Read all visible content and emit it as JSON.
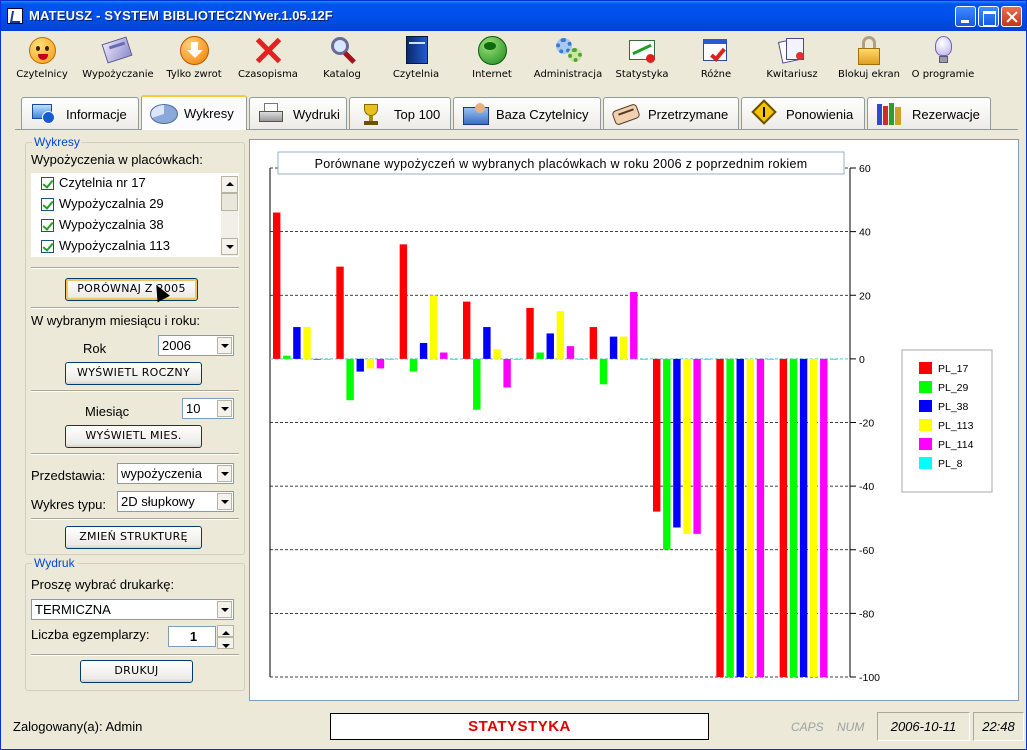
{
  "window": {
    "title": "MATEUSZ - SYSTEM BIBLIOTECZNY",
    "version": "ver.1.05.12F"
  },
  "toolbar": {
    "items": [
      {
        "label": "Czytelnicy",
        "icon": "smiley-icon"
      },
      {
        "label": "Wypożyczanie",
        "icon": "book-transfer-icon"
      },
      {
        "label": "Tylko zwrot",
        "icon": "orange-down-arrow-icon"
      },
      {
        "label": "Czasopisma",
        "icon": "red-x-icon"
      },
      {
        "label": "Katalog",
        "icon": "magnifier-icon"
      },
      {
        "label": "Czytelnia",
        "icon": "blue-book-icon"
      },
      {
        "label": "Internet",
        "icon": "globe-icon"
      },
      {
        "label": "Administracja",
        "icon": "gears-icon"
      },
      {
        "label": "Statystyka",
        "icon": "chart-icon"
      },
      {
        "label": "Różne",
        "icon": "calendar-check-icon"
      },
      {
        "label": "Kwitariusz",
        "icon": "receipts-icon"
      },
      {
        "label": "Blokuj ekran",
        "icon": "padlock-icon"
      },
      {
        "label": "O programie",
        "icon": "lightbulb-icon"
      }
    ]
  },
  "tabs": [
    {
      "label": "Informacje",
      "icon": "computer-info-icon"
    },
    {
      "label": "Wykresy",
      "icon": "pie-chart-icon"
    },
    {
      "label": "Wydruki",
      "icon": "printer-icon"
    },
    {
      "label": "Top 100",
      "icon": "trophy-icon"
    },
    {
      "label": "Baza Czytelnicy",
      "icon": "folder-people-icon"
    },
    {
      "label": "Przetrzymane",
      "icon": "hand-clock-icon"
    },
    {
      "label": "Ponowienia",
      "icon": "warning-sign-icon"
    },
    {
      "label": "Rezerwacje",
      "icon": "books-shelf-icon"
    }
  ],
  "wykresy": {
    "legend": "Wykresy",
    "loans_label": "Wypożyczenia w placówkach:",
    "branches": [
      "Czytelnia nr 17",
      "Wypożyczalnia 29",
      "Wypożyczalnia 38",
      "Wypożyczalnia 113"
    ],
    "compare_button": "PORÓWNAJ Z 2005",
    "month_year_label": "W wybranym miesiącu i roku:",
    "year_label": "Rok",
    "year_value": "2006",
    "show_yearly_button": "WYŚWIETL ROCZNY",
    "month_label": "Miesiąc",
    "month_value": "10",
    "show_monthly_button": "WYŚWIETL MIES.",
    "represents_label": "Przedstawia:",
    "represents_value": "wypożyczenia",
    "chart_type_label": "Wykres typu:",
    "chart_type_value": "2D słupkowy",
    "change_structure_button": "ZMIEŃ STRUKTURĘ"
  },
  "wydruk": {
    "legend": "Wydruk",
    "printer_label": "Proszę wybrać drukarkę:",
    "printer_value": "TERMICZNA",
    "copies_label": "Liczba egzemplarzy:",
    "copies_value": "1",
    "print_button": "DRUKUJ"
  },
  "status": {
    "logged_in": "Zalogowany(a): Admin",
    "module": "STATYSTYKA",
    "caps": "CAPS",
    "num": "NUM",
    "date": "2006-10-11",
    "time": "22:48"
  },
  "chart_data": {
    "type": "bar",
    "title": "Porównane wypożyczeń w wybranych placówkach w roku 2006 z poprzednim rokiem",
    "ylim": [
      -100,
      60
    ],
    "yticks": [
      60,
      40,
      20,
      0,
      -20,
      -40,
      -60,
      -80,
      -100
    ],
    "grid": true,
    "legend_position": "right",
    "series": [
      {
        "name": "PL_17",
        "color": "#ff0000",
        "values": [
          46,
          29,
          36,
          18,
          16,
          10,
          -48,
          -100,
          -100
        ]
      },
      {
        "name": "PL_29",
        "color": "#00ff00",
        "values": [
          1,
          -13,
          -4,
          -16,
          2,
          -8,
          -60,
          -100,
          -100
        ]
      },
      {
        "name": "PL_38",
        "color": "#0000ff",
        "values": [
          10,
          -4,
          5,
          10,
          8,
          7,
          -53,
          -100,
          -100
        ]
      },
      {
        "name": "PL_113",
        "color": "#ffff00",
        "values": [
          10,
          -3,
          20,
          3,
          15,
          7,
          -55,
          -100,
          -100
        ]
      },
      {
        "name": "PL_114",
        "color": "#ff00ff",
        "values": [
          0,
          -3,
          2,
          -9,
          4,
          21,
          -55,
          -100,
          -100
        ]
      },
      {
        "name": "PL_8",
        "color": "#00ffff",
        "values": [
          0,
          0,
          0,
          0,
          0,
          0,
          0,
          0,
          0
        ]
      }
    ]
  }
}
